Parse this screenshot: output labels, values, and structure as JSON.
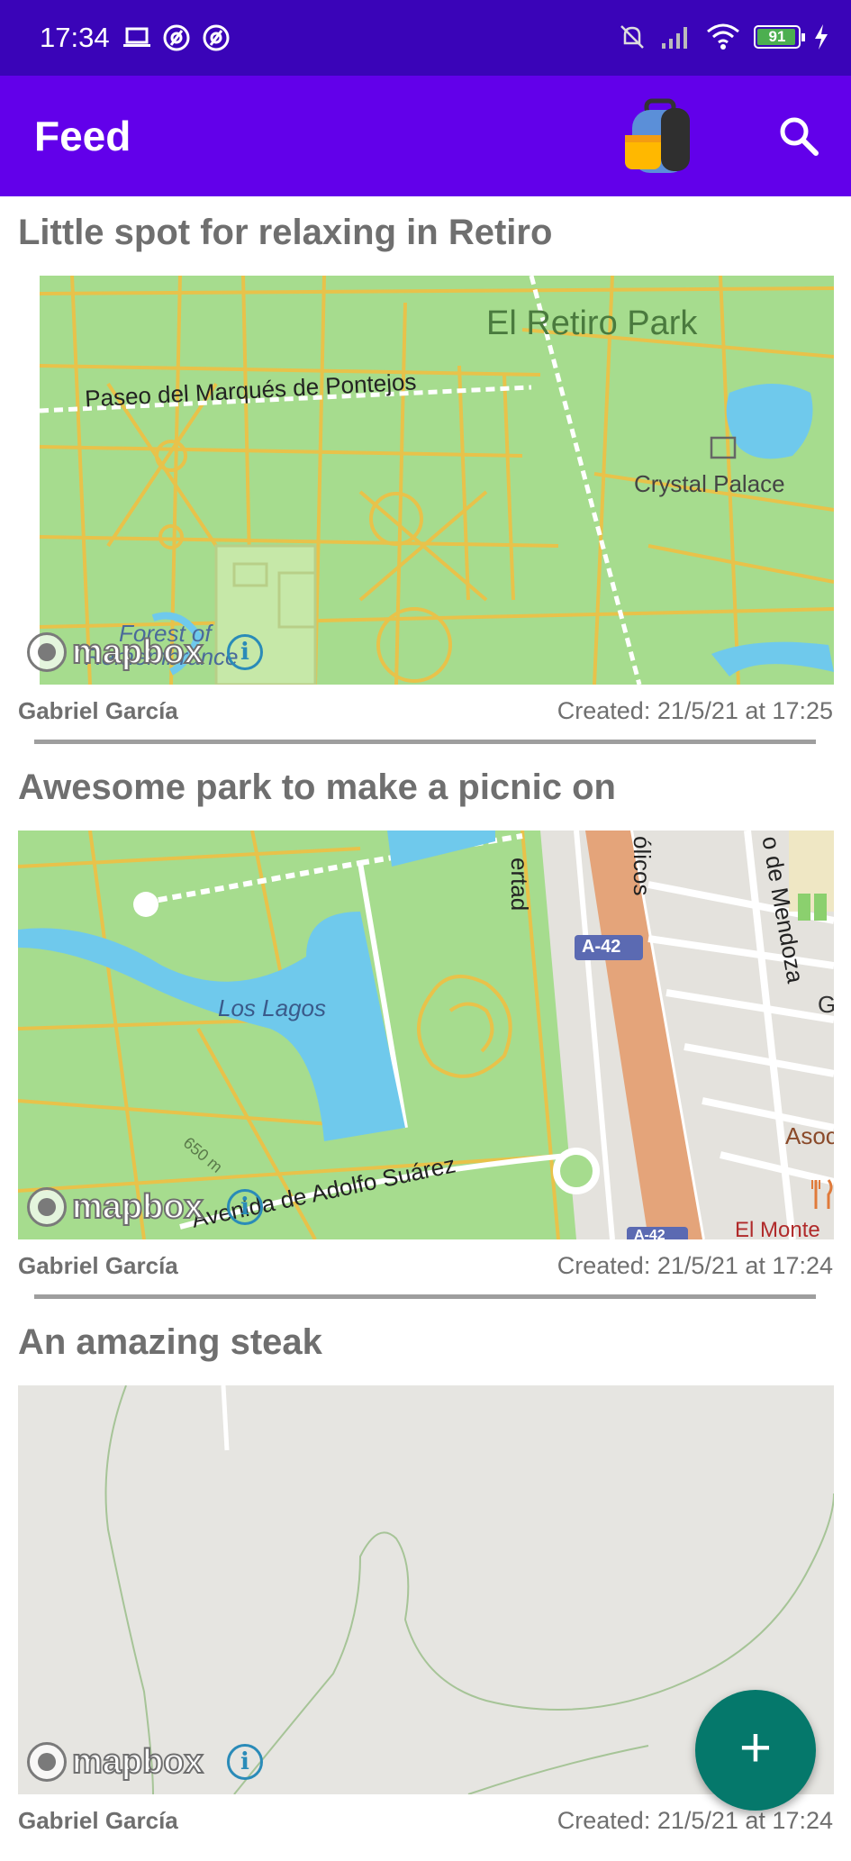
{
  "status_bar": {
    "time": "17:34",
    "battery": "91",
    "icons_left": [
      "laptop-icon",
      "at-icon",
      "at-icon"
    ],
    "icons_right": [
      "mute-icon",
      "signal-icon",
      "wifi-icon",
      "battery-icon",
      "charging-icon"
    ]
  },
  "app_bar": {
    "title": "Feed",
    "logo_icon": "backpack-icon",
    "search_icon": "search-icon"
  },
  "colors": {
    "status_bar": "#3a04b8",
    "app_bar": "#6200ea",
    "fab": "#05786b",
    "text_secondary": "#6f6f6f"
  },
  "posts": [
    {
      "title": "Little spot for relaxing in Retiro",
      "author": "Gabriel García",
      "created": "Created: 21/5/21 at 17:25",
      "map": {
        "attribution": "mapbox",
        "labels": [
          "El Retiro Park",
          "Paseo del Marqués de Pontejos",
          "Crystal Palace",
          "Forest of",
          "Remembrance"
        ]
      }
    },
    {
      "title": "Awesome park to make a picnic on",
      "author": "Gabriel García",
      "created": "Created: 21/5/21 at 17:24",
      "map": {
        "attribution": "mapbox",
        "labels": [
          "Los Lagos",
          "Avenida de Adolfo Suárez",
          "A-42",
          "A-42",
          "ertad",
          "ólicos",
          "o de Mendoza",
          "Asoc",
          "El Monte",
          "650 m",
          "G"
        ]
      }
    },
    {
      "title": "An amazing steak",
      "author": "Gabriel García",
      "created": "Created: 21/5/21 at 17:24",
      "map": {
        "attribution": "mapbox",
        "labels": []
      }
    }
  ],
  "fab": {
    "label": "+",
    "icon": "add-icon"
  }
}
